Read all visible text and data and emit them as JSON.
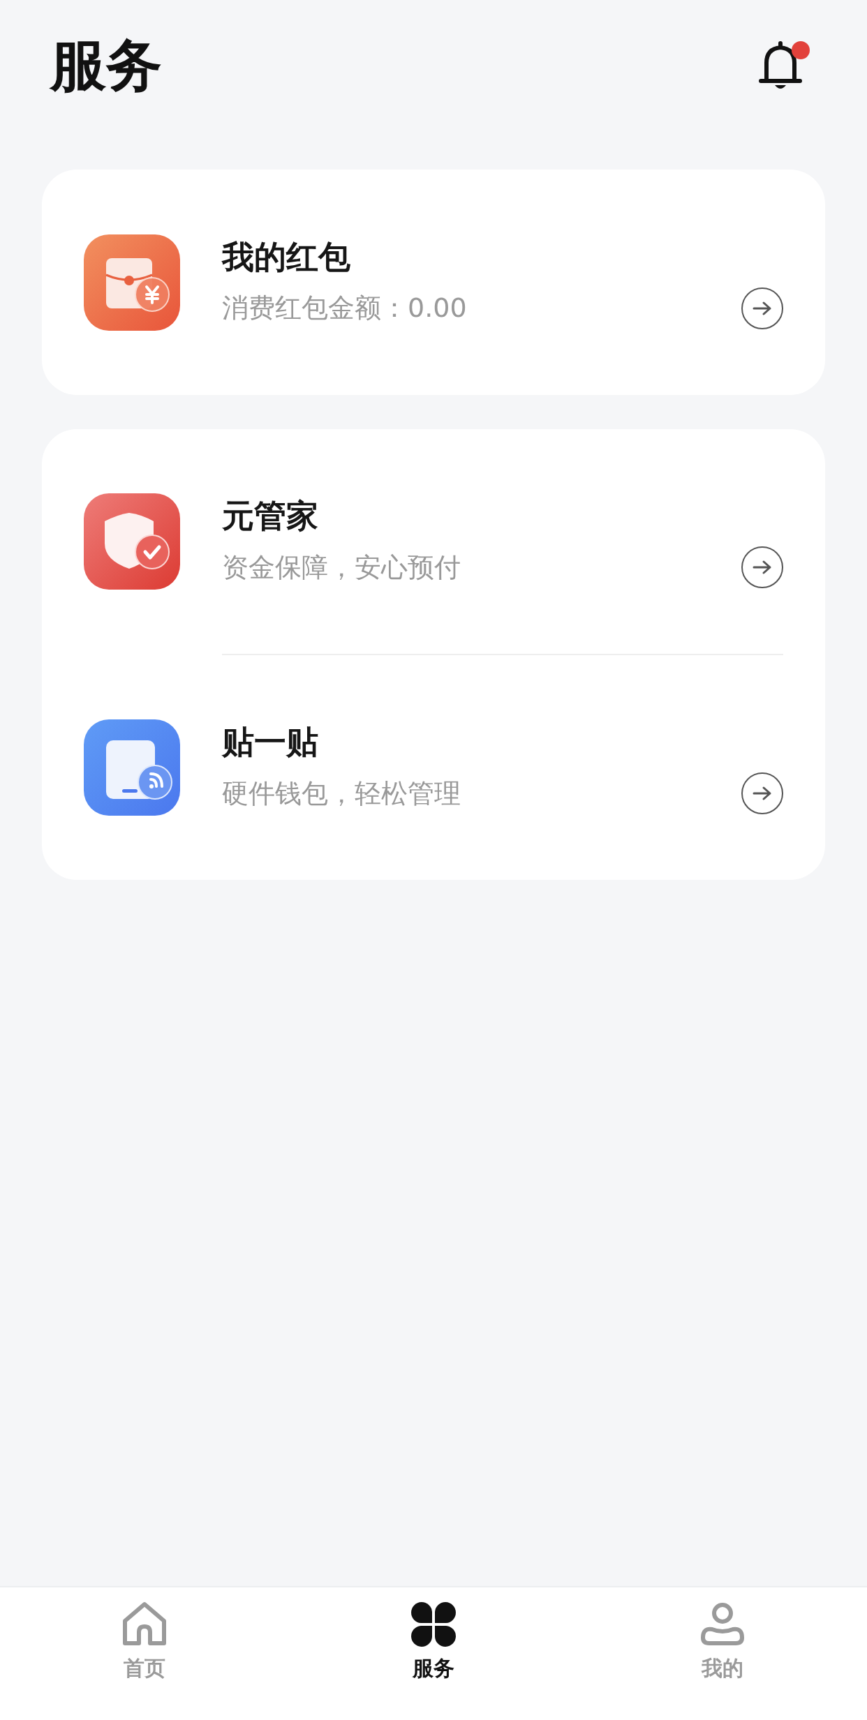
{
  "header": {
    "title": "服务",
    "notification": {
      "unread": true
    }
  },
  "cards": [
    {
      "items": [
        {
          "kind": "red-packet",
          "title": "我的红包",
          "subtitle": "消费红包金额：0.00"
        }
      ]
    },
    {
      "items": [
        {
          "kind": "shield",
          "title": "元管家",
          "subtitle": "资金保障，安心预付"
        },
        {
          "kind": "nfc-card",
          "title": "贴一贴",
          "subtitle": "硬件钱包，轻松管理"
        }
      ]
    }
  ],
  "tab_bar": [
    {
      "kind": "home",
      "label": "首页",
      "selected": false
    },
    {
      "kind": "services",
      "label": "服务",
      "selected": true
    },
    {
      "kind": "profile",
      "label": "我的",
      "selected": false
    }
  ]
}
